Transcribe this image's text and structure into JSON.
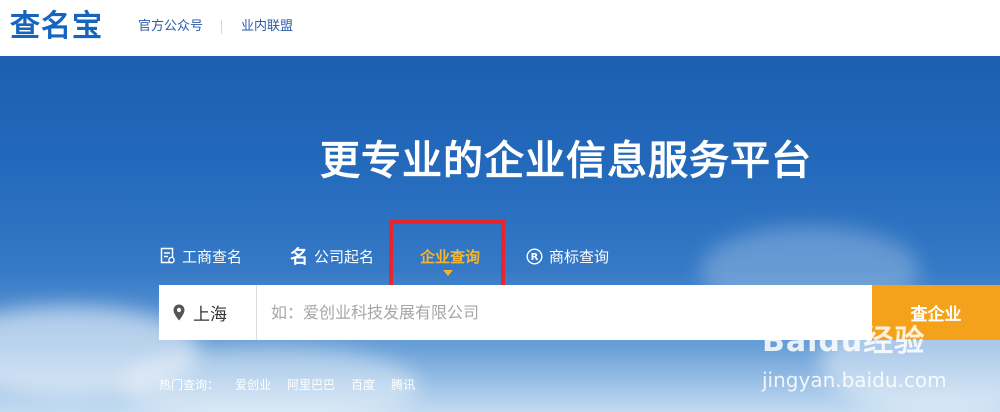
{
  "header": {
    "logo": "查名宝",
    "links": [
      "官方公众号",
      "业内联盟"
    ]
  },
  "hero": {
    "headline": "更专业的企业信息服务平台"
  },
  "tabs": [
    {
      "label": "工商查名",
      "icon": "document-icon",
      "active": false
    },
    {
      "label": "公司起名",
      "icon": "name-icon",
      "active": false
    },
    {
      "label": "企业查询",
      "icon": "",
      "active": true
    },
    {
      "label": "商标查询",
      "icon": "registered-icon",
      "active": false
    }
  ],
  "search": {
    "city": "上海",
    "placeholder": "如：爱创业科技发展有限公司",
    "value": "",
    "button": "查企业"
  },
  "hot_queries": {
    "label": "热门查询：",
    "items": [
      "爱创业",
      "阿里巴巴",
      "百度",
      "腾讯"
    ]
  },
  "watermark": {
    "logo": "Baidu经验",
    "url": "jingyan.baidu.com"
  },
  "colors": {
    "brand": "#1565c0",
    "accent": "#f4a21c",
    "active_tab": "#f5b530",
    "highlight_box": "#e8252c"
  }
}
